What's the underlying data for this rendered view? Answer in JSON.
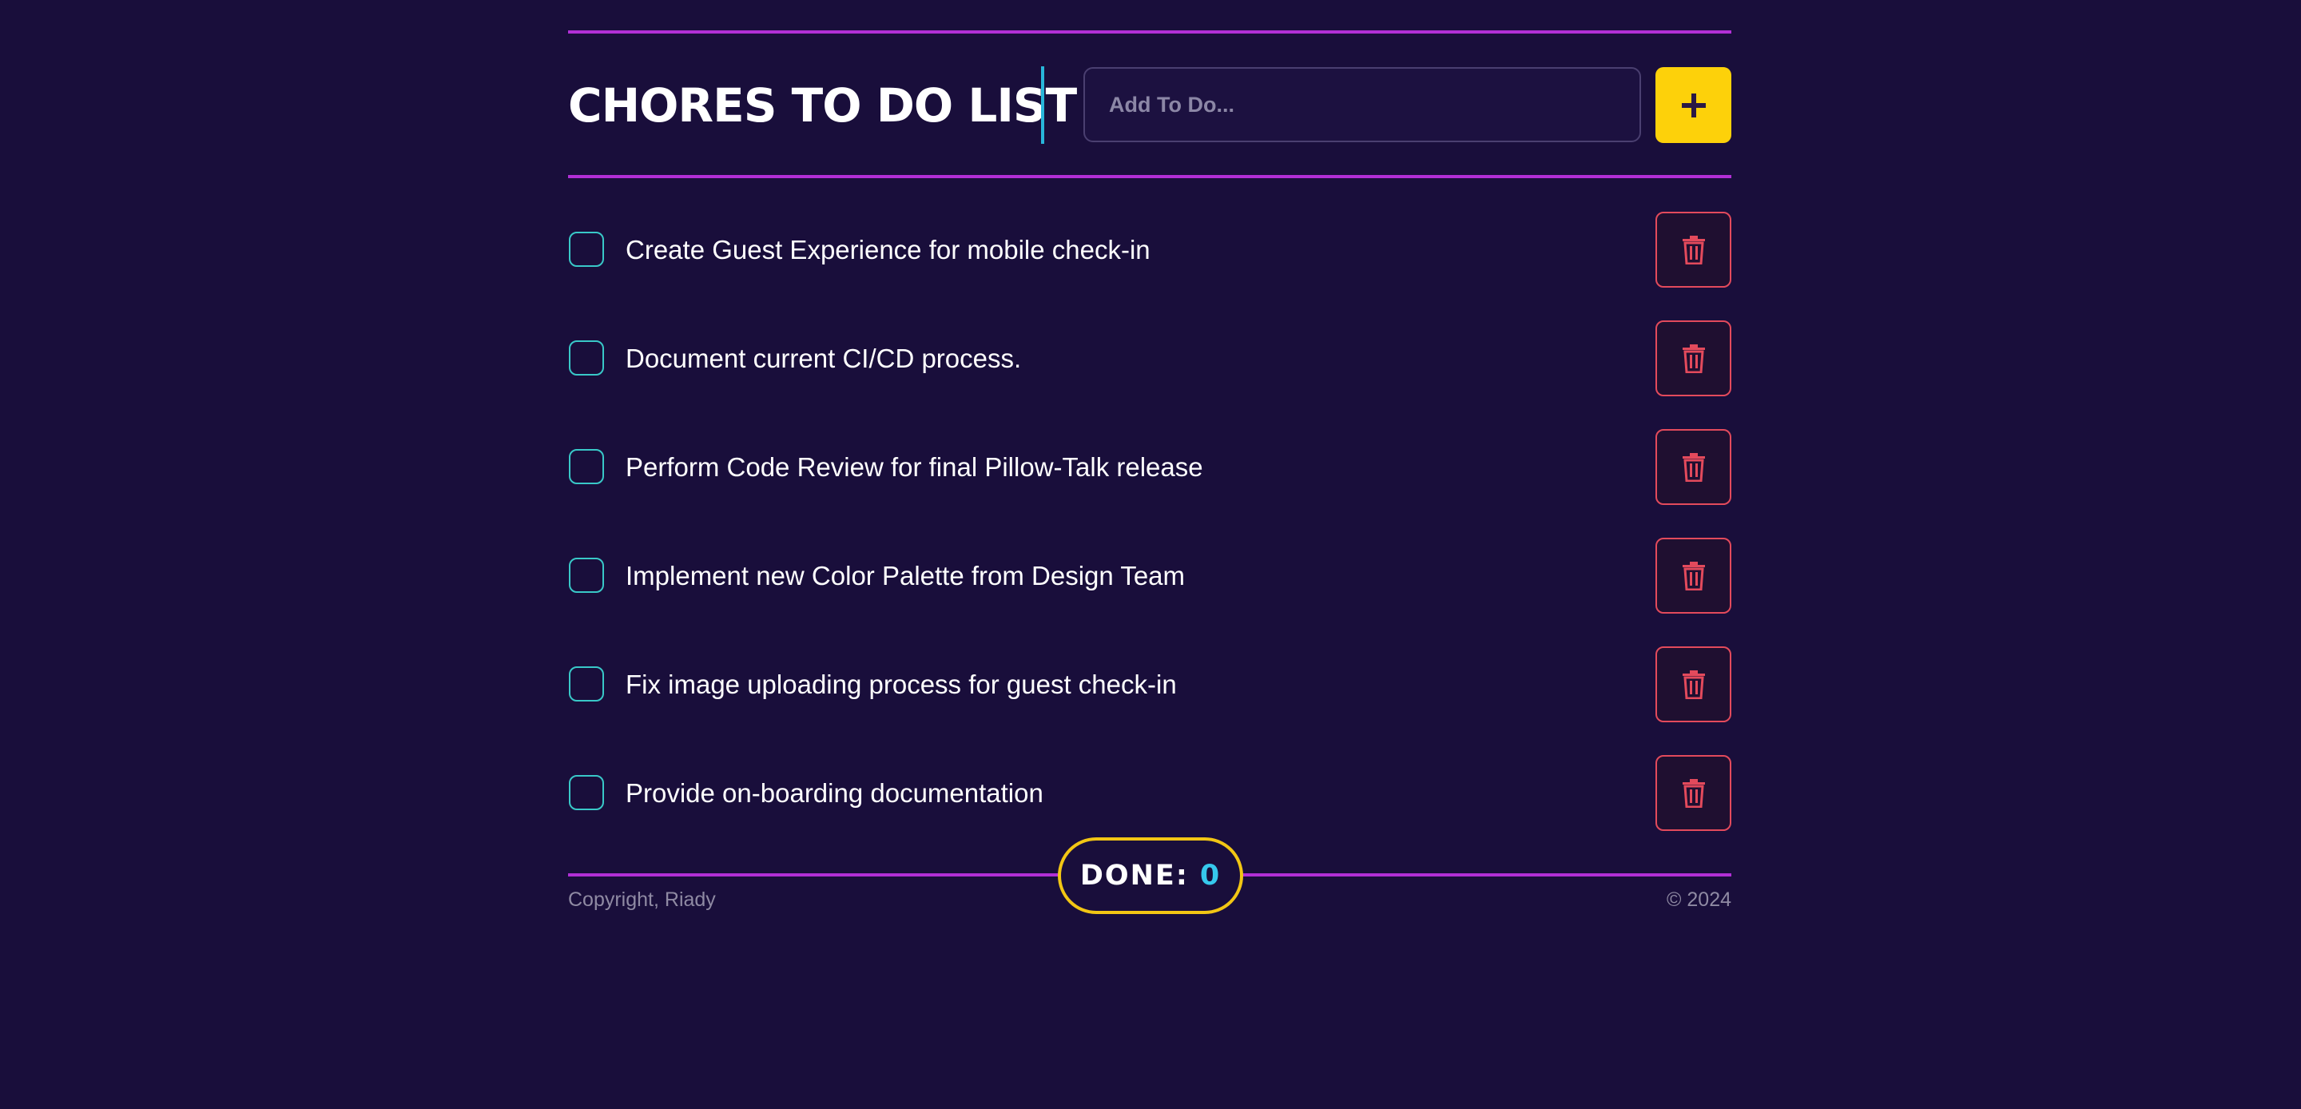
{
  "header": {
    "title": "CHORES TO DO LIST",
    "input_placeholder": "Add To Do...",
    "input_value": "",
    "add_button_icon": "plus-icon"
  },
  "todos": [
    {
      "text": "Create Guest Experience for mobile check-in",
      "done": false
    },
    {
      "text": "Document current CI/CD process.",
      "done": false
    },
    {
      "text": "Perform Code Review for final Pillow-Talk release",
      "done": false
    },
    {
      "text": "Implement new Color Palette from Design Team",
      "done": false
    },
    {
      "text": "Fix image uploading process for guest check-in",
      "done": false
    },
    {
      "text": "Provide on-boarding documentation",
      "done": false
    }
  ],
  "done_counter": {
    "label": "DONE:",
    "count": "0"
  },
  "footer": {
    "left": "Copyright, Riady",
    "right": "© 2024"
  },
  "colors": {
    "background": "#190e3b",
    "divider": "#b22fd6",
    "accent_cyan": "#28b6da",
    "add_button": "#fdd10a",
    "delete_border": "#e34a5c",
    "checkbox_border": "#39c8c8",
    "done_border": "#f2c614"
  }
}
